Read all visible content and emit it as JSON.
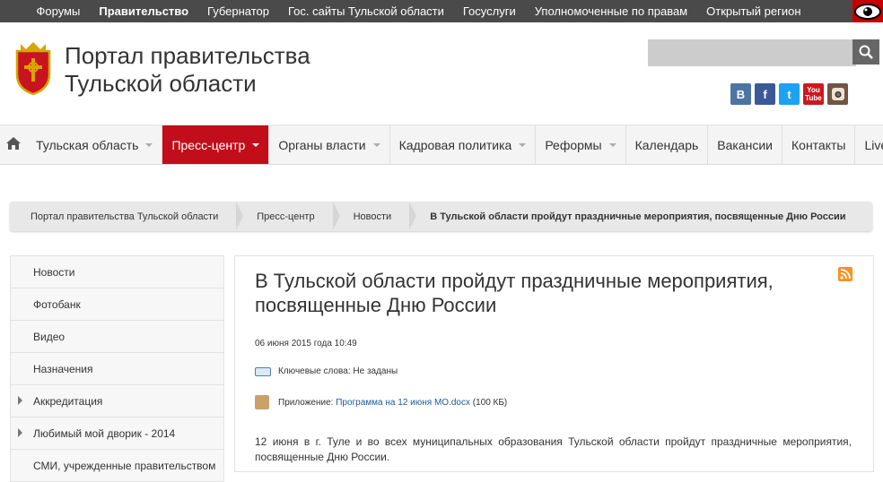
{
  "topbar": {
    "links": [
      "Форумы",
      "Правительство",
      "Губернатор",
      "Гос. сайты Тульской области",
      "Госуслуги",
      "Уполномоченные по правам",
      "Открытый регион"
    ],
    "accessibility_icon": "eye-icon"
  },
  "header": {
    "title_line1": "Портал правительства",
    "title_line2": "Тульской области",
    "search_placeholder": "",
    "social": [
      {
        "icon": "vk-icon",
        "text": "В",
        "color": "#4c75a3"
      },
      {
        "icon": "facebook-icon",
        "text": "f",
        "color": "#3b5998"
      },
      {
        "icon": "twitter-icon",
        "text": "t",
        "color": "#1da1f2"
      },
      {
        "icon": "youtube-icon",
        "text": "You Tube",
        "color": "#cc181e"
      },
      {
        "icon": "instagram-icon",
        "text": "",
        "color": "#6f5646"
      }
    ]
  },
  "nav": {
    "items": [
      {
        "label": "Тульская область",
        "caret": true,
        "active": false
      },
      {
        "label": "Пресс-центр",
        "caret": true,
        "active": true
      },
      {
        "label": "Органы власти",
        "caret": true,
        "active": false
      },
      {
        "label": "Кадровая политика",
        "caret": true,
        "active": false
      },
      {
        "label": "Реформы",
        "caret": true,
        "active": false
      },
      {
        "label": "Календарь",
        "caret": false,
        "active": false
      },
      {
        "label": "Вакансии",
        "caret": false,
        "active": false
      },
      {
        "label": "Контакты",
        "caret": false,
        "active": false
      },
      {
        "label": "Live!",
        "caret": true,
        "active": false
      }
    ]
  },
  "breadcrumb": [
    "Портал правительства Тульской области",
    "Пресс-центр",
    "Новости",
    "В Тульской области пройдут праздничные мероприятия, посвященные Дню России"
  ],
  "sidebar": [
    {
      "label": "Новости",
      "arrow": false
    },
    {
      "label": "Фотобанк",
      "arrow": false
    },
    {
      "label": "Видео",
      "arrow": false
    },
    {
      "label": "Назначения",
      "arrow": false
    },
    {
      "label": "Аккредитация",
      "arrow": true
    },
    {
      "label": "Любимый мой дворик - 2014",
      "arrow": true
    },
    {
      "label": "СМИ, учрежденные правительством",
      "arrow": false
    }
  ],
  "article": {
    "title": "В Тульской области пройдут праздничные мероприятия, посвященные Дню России",
    "date": "06 июня 2015 года 10:49",
    "keywords_label": "Ключевые слова:",
    "keywords_value": "Не заданы",
    "attachment_label": "Приложение:",
    "attachment_file": "Программа на 12 июня МО.docx",
    "attachment_size": "(100 КБ)",
    "body": "12 июня в г. Туле и во всех муниципальных образования Тульской области пройдут праздничные мероприятия, посвященные Дню России."
  },
  "colors": {
    "topbar_bg": "#4a4a4a",
    "accent_red": "#c20e1a",
    "link_blue": "#1a5a9a"
  }
}
